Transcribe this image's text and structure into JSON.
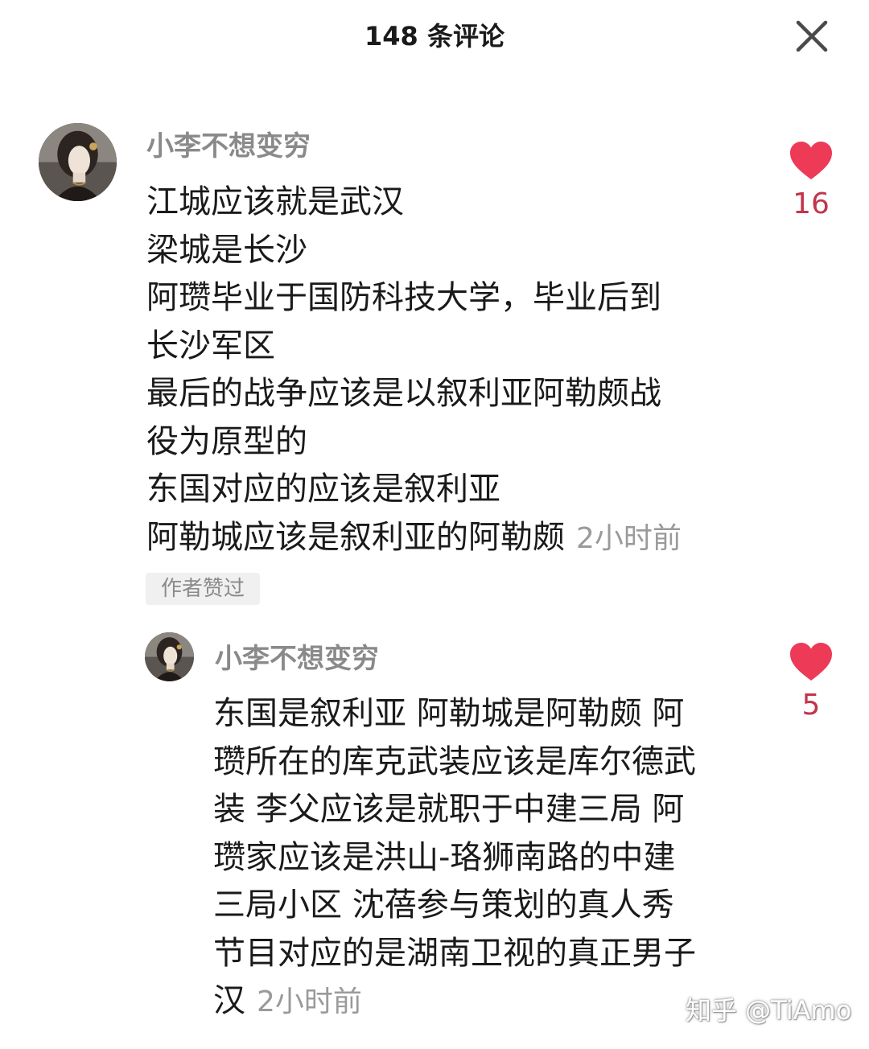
{
  "header": {
    "title": "148 条评论",
    "close_icon": "close-icon"
  },
  "comments": [
    {
      "username": "小李不想变穷",
      "avatar_icon": "avatar-illustrated-woman",
      "lines": [
        "江城应该就是武汉",
        "梁城是长沙",
        "阿瓒毕业于国防科技大学，毕业后到",
        "长沙军区",
        "最后的战争应该是以叙利亚阿勒颇战",
        "役为原型的",
        "东国对应的应该是叙利亚",
        "阿勒城应该是叙利亚的阿勒颇"
      ],
      "time": "2小时前",
      "badge": "作者赞过",
      "likes": "16",
      "like_icon": "heart-icon",
      "like_color": "#ec3a57"
    },
    {
      "username": "小李不想变穷",
      "avatar_icon": "avatar-illustrated-woman",
      "lines": [
        "东国是叙利亚 阿勒城是阿勒颇 阿",
        "瓒所在的库克武装应该是库尔德武",
        "装 李父应该是就职于中建三局 阿",
        "瓒家应该是洪山-珞狮南路的中建",
        "三局小区 沈蓓参与策划的真人秀",
        "节目对应的是湖南卫视的真正男子",
        "汉"
      ],
      "time": "2小时前",
      "likes": "5",
      "like_icon": "heart-icon",
      "like_color": "#ec3a57"
    }
  ],
  "watermark": "知乎 @TiAmo"
}
